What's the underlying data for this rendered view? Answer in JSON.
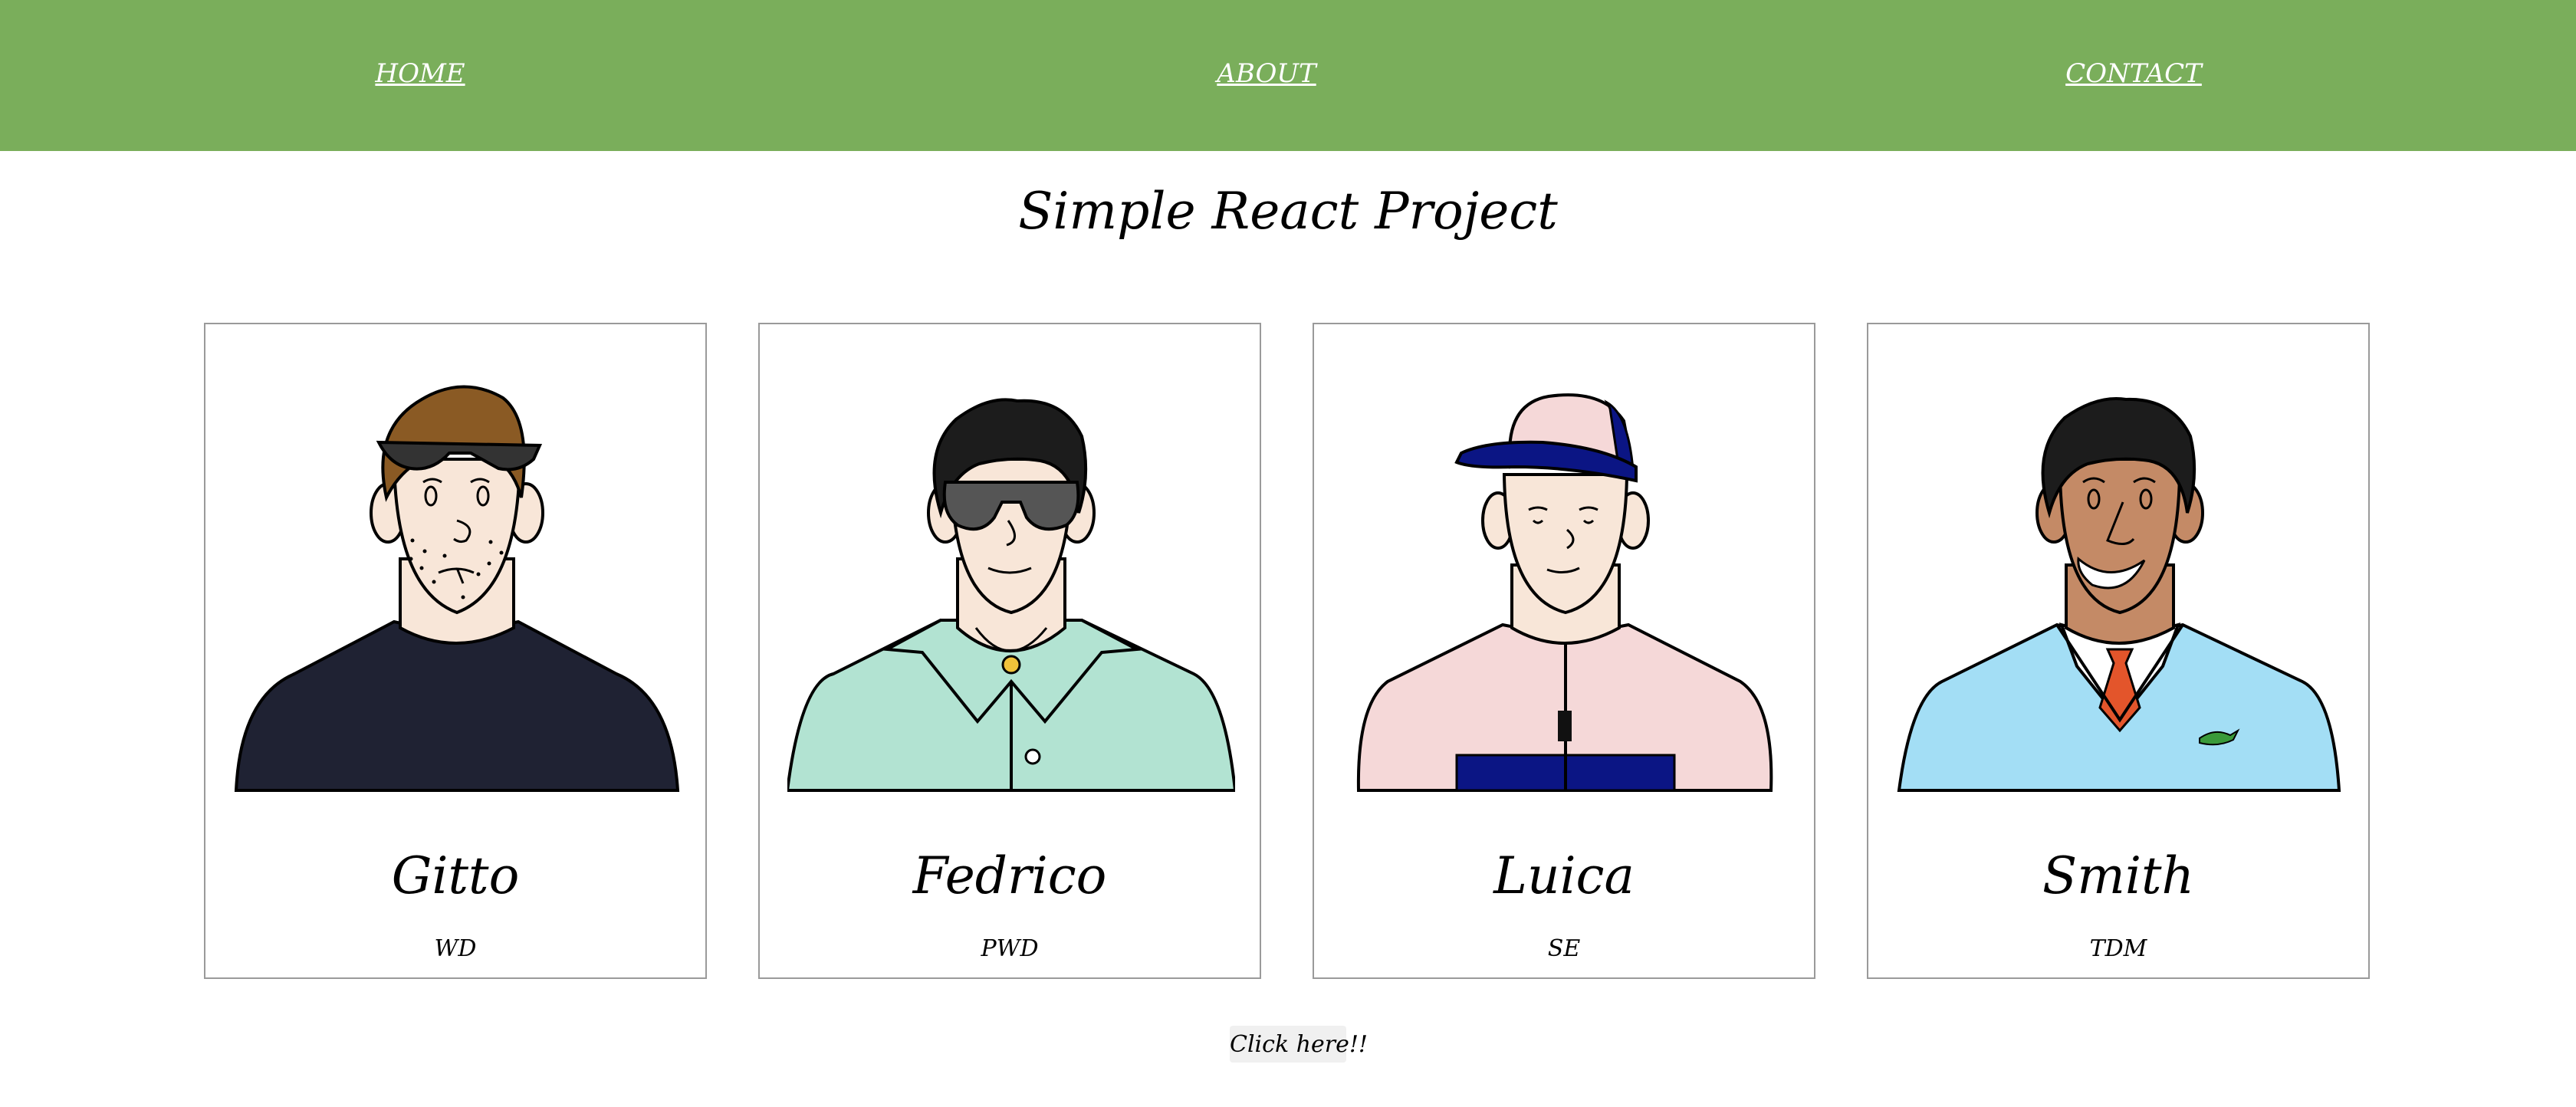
{
  "nav": {
    "home_label": "HOME",
    "about_label": "ABOUT",
    "contact_label": "CONTACT"
  },
  "page_title": "Simple React Project",
  "cards": [
    {
      "name": "Gitto",
      "role": "WD"
    },
    {
      "name": "Fedrico",
      "role": "PWD"
    },
    {
      "name": "Luica",
      "role": "SE"
    },
    {
      "name": "Smith",
      "role": "TDM"
    }
  ],
  "cta_label": "Click here!!",
  "colors": {
    "navbar": "#7aae5b",
    "nav_text": "#ffffff",
    "card_border": "#9a9a9a",
    "skin_light": "#f8e6d8",
    "skin_dark": "#c48a66",
    "shirt_navy": "#1f2233",
    "shirt_mint": "#b2e3d2",
    "jacket_pink": "#f5d8d8",
    "sweater_blue": "#a3def5"
  }
}
